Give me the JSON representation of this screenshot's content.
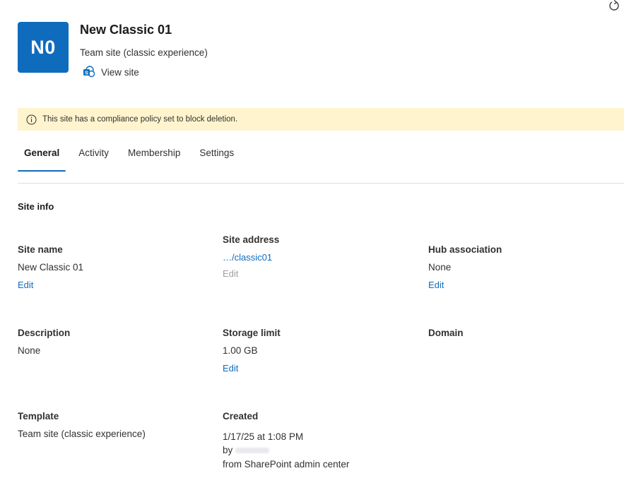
{
  "header": {
    "avatar_initials": "N0",
    "title": "New Classic 01",
    "subtitle": "Team site (classic experience)",
    "view_site_label": "View site"
  },
  "banner": {
    "text": "This site has a compliance policy set to block deletion."
  },
  "tabs": [
    {
      "label": "General",
      "active": true
    },
    {
      "label": "Activity",
      "active": false
    },
    {
      "label": "Membership",
      "active": false
    },
    {
      "label": "Settings",
      "active": false
    }
  ],
  "site_info": {
    "heading": "Site info",
    "site_name": {
      "label": "Site name",
      "value": "New Classic 01",
      "edit": "Edit"
    },
    "site_address": {
      "label": "Site address",
      "value": "…/classic01",
      "edit": "Edit"
    },
    "hub_association": {
      "label": "Hub association",
      "value": "None",
      "edit": "Edit"
    },
    "description": {
      "label": "Description",
      "value": "None"
    },
    "storage_limit": {
      "label": "Storage limit",
      "value": "1.00 GB",
      "edit": "Edit"
    },
    "domain": {
      "label": "Domain"
    },
    "template": {
      "label": "Template",
      "value": "Team site (classic experience)"
    },
    "created": {
      "label": "Created",
      "date": "1/17/25 at 1:08 PM",
      "by": "by",
      "source": "from SharePoint admin center"
    }
  },
  "colors": {
    "accent": "#0f6cbd",
    "banner_bg": "#fff4ce",
    "disabled_text": "#a19f9d"
  }
}
